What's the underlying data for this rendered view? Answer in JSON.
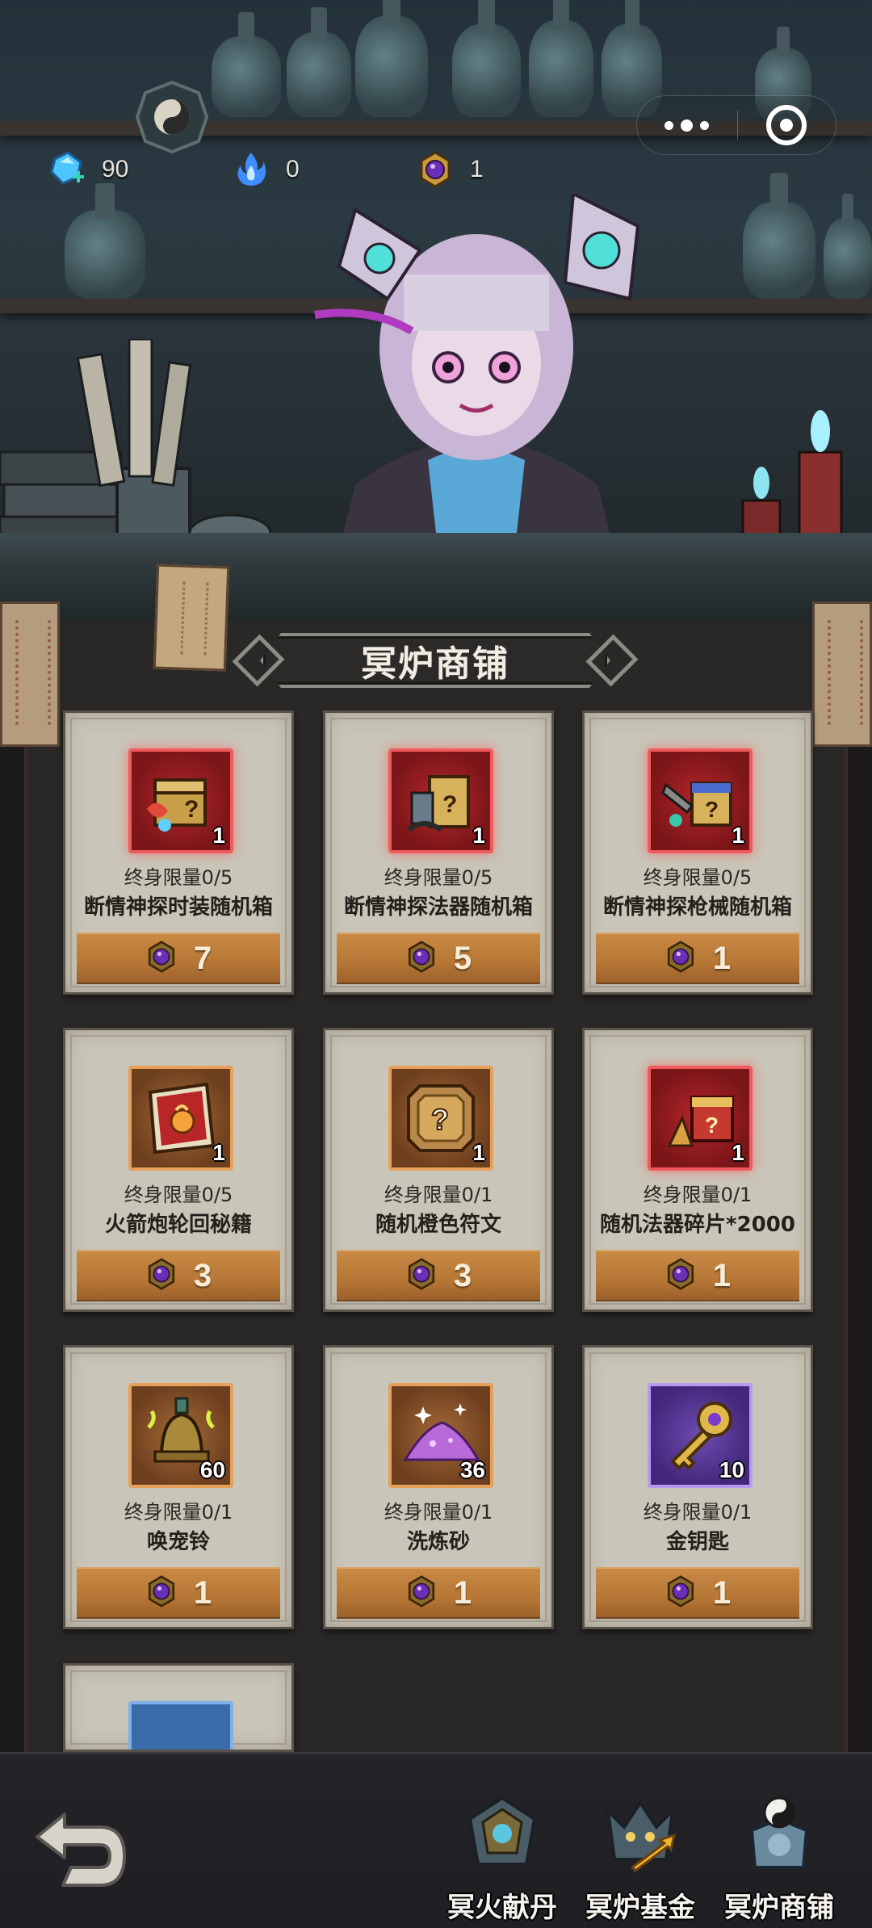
{
  "currency": {
    "gems": {
      "icon": "gem-plus-icon",
      "value": "90"
    },
    "blue_fire": {
      "icon": "blue-fire-icon",
      "value": "0"
    },
    "coin": {
      "icon": "purple-coin-icon",
      "value": "1"
    }
  },
  "shop": {
    "title": "冥炉商铺",
    "price_icon": "purple-coin-icon",
    "items": [
      {
        "name": "断情神探时装随机箱",
        "limit": "终身限量0/5",
        "count": "1",
        "price": "7",
        "frame": "red",
        "icon": "fashion-chest-icon"
      },
      {
        "name": "断情神探法器随机箱",
        "limit": "终身限量0/5",
        "count": "1",
        "price": "5",
        "frame": "red",
        "icon": "artifact-chest-icon"
      },
      {
        "name": "断情神探枪械随机箱",
        "limit": "终身限量0/5",
        "count": "1",
        "price": "1",
        "frame": "red",
        "icon": "weapon-chest-icon"
      },
      {
        "name": "火箭炮轮回秘籍",
        "limit": "终身限量0/5",
        "count": "1",
        "price": "3",
        "frame": "orange",
        "icon": "secret-book-icon"
      },
      {
        "name": "随机橙色符文",
        "limit": "终身限量0/1",
        "count": "1",
        "price": "3",
        "frame": "orange",
        "icon": "rune-icon"
      },
      {
        "name": "随机法器碎片*2000",
        "limit": "终身限量0/1",
        "count": "1",
        "price": "1",
        "frame": "red",
        "icon": "artifact-fragment-icon"
      },
      {
        "name": "唤宠铃",
        "limit": "终身限量0/1",
        "count": "60",
        "price": "1",
        "frame": "orange",
        "icon": "bell-icon"
      },
      {
        "name": "洗炼砂",
        "limit": "终身限量0/1",
        "count": "36",
        "price": "1",
        "frame": "orange",
        "icon": "sand-pile-icon"
      },
      {
        "name": "金钥匙",
        "limit": "终身限量0/1",
        "count": "10",
        "price": "1",
        "frame": "purple",
        "icon": "golden-key-icon"
      }
    ]
  },
  "nav": {
    "back_icon": "back-arrow-icon",
    "tabs": [
      {
        "label": "冥火献丹",
        "icon": "offering-shrine-icon"
      },
      {
        "label": "冥炉基金",
        "icon": "fund-dragon-icon"
      },
      {
        "label": "冥炉商铺",
        "icon": "shop-yinyang-icon",
        "active": true
      }
    ]
  }
}
